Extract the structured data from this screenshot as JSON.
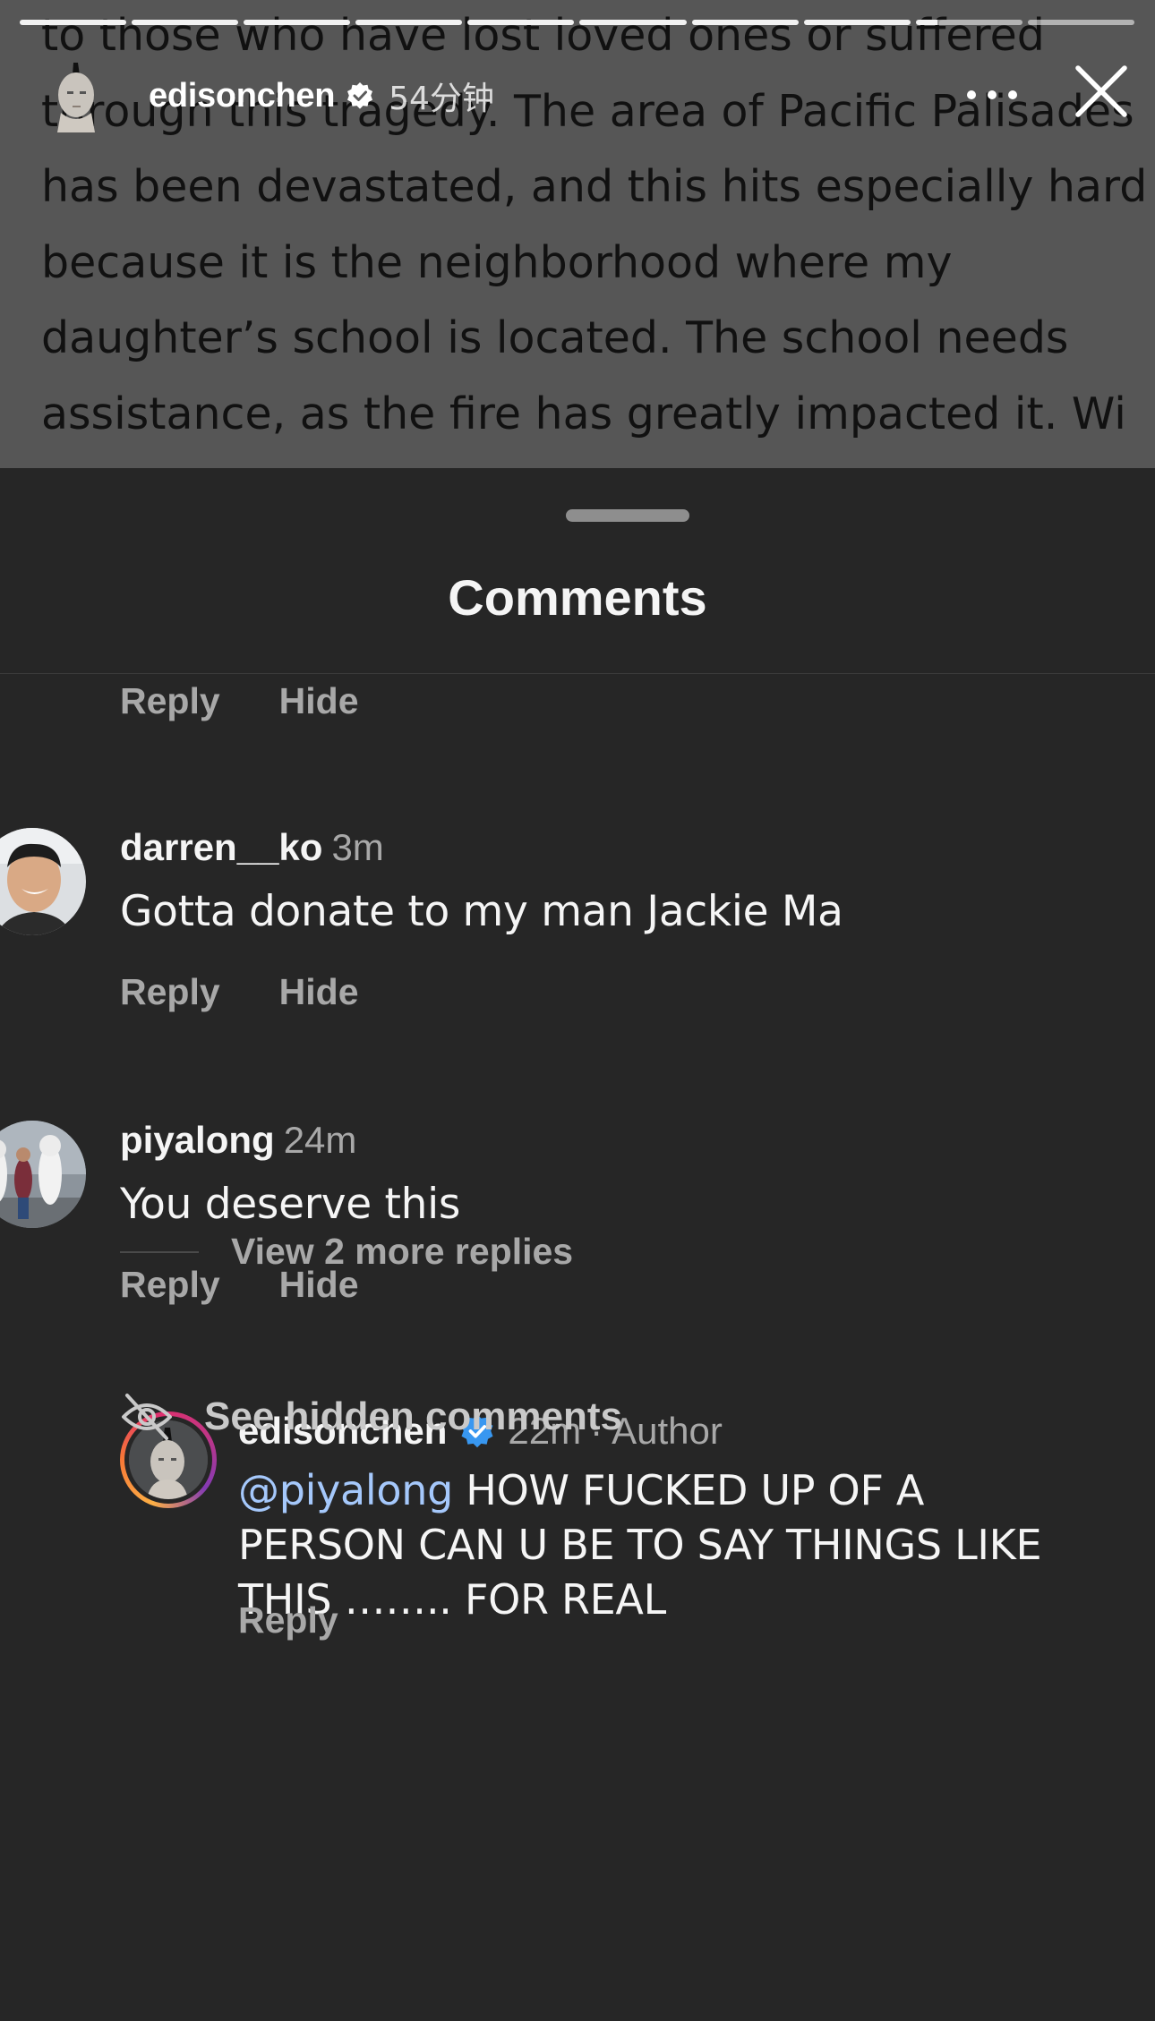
{
  "story": {
    "text_lines": [
      "to those who have lost loved ones or suffered",
      "through this tragedy. The area of Pacific Palisades",
      "has been devastated, and this hits especially hard",
      "because it is the neighborhood where my",
      "daughter’s school is located. The school needs",
      "assistance, as the fire has greatly impacted it. Wi"
    ],
    "username": "edisonchen",
    "time": "54分钟",
    "progress": {
      "segments": 10,
      "completed": 8,
      "current_fraction": 0.2
    },
    "icons": {
      "more": "more-dots-icon",
      "close": "close-icon",
      "verified": "verified-badge-icon"
    }
  },
  "sheet": {
    "title": "Comments"
  },
  "actions": {
    "reply": "Reply",
    "hide": "Hide"
  },
  "comments": [
    {
      "username": "darren__ko",
      "time": "3m",
      "text": "Gotta donate to my man Jackie Ma"
    },
    {
      "username": "piyalong",
      "time": "24m",
      "text": "You deserve this"
    }
  ],
  "reply": {
    "username": "edisonchen",
    "time": "22m",
    "separator": "·",
    "role": "Author",
    "mention": "@piyalong",
    "text": "HOW FUCKED UP OF A PERSON CAN U BE TO SAY THINGS LIKE THIS …….. FOR REAL",
    "reply_label": "Reply"
  },
  "view_more": "View 2 more replies",
  "hidden_comments": "See hidden comments",
  "colors": {
    "background": "#262626",
    "mention": "#a5c8fb",
    "verified": "#3897f0",
    "secondary_text": "#a8a8a8"
  }
}
